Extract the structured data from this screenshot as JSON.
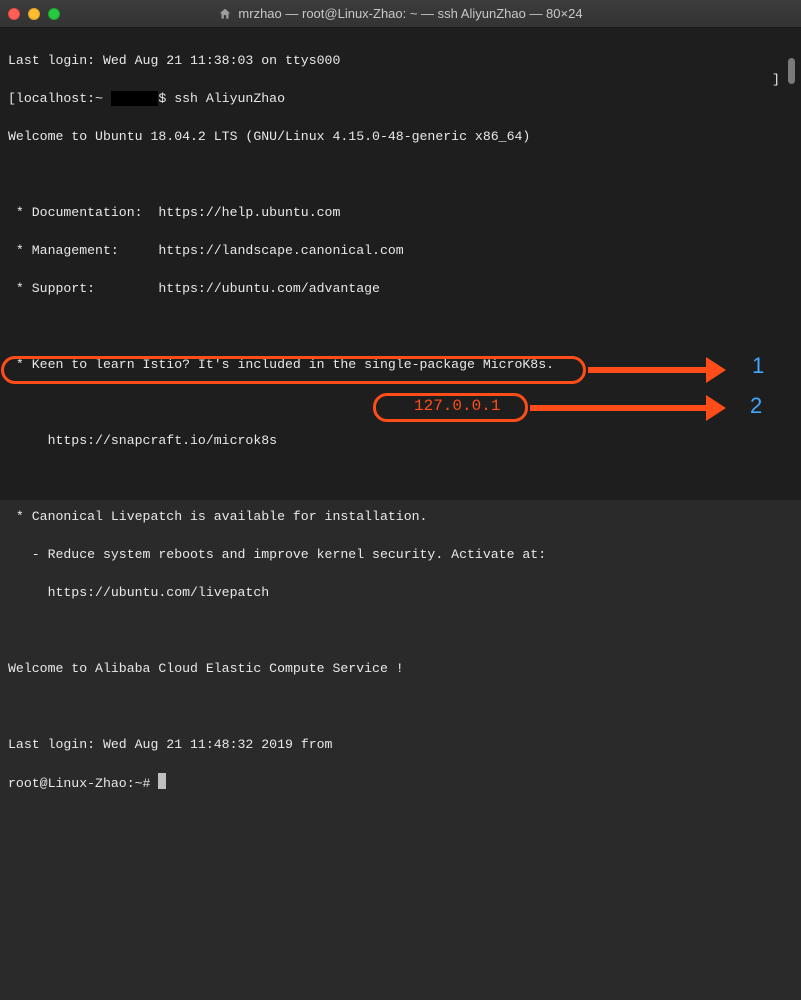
{
  "window": {
    "title": "mrzhao — root@Linux-Zhao: ~ — ssh AliyunZhao — 80×24"
  },
  "terminal": {
    "line1": "Last login: Wed Aug 21 11:38:03 on ttys000",
    "prompt_local_left": "[localhost:~ ",
    "prompt_local_right": "$ ssh AliyunZhao",
    "rbracket": "]",
    "welcome": "Welcome to Ubuntu 18.04.2 LTS (GNU/Linux 4.15.0-48-generic x86_64)",
    "doc": " * Documentation:  https://help.ubuntu.com",
    "mgmt": " * Management:     https://landscape.canonical.com",
    "support": " * Support:        https://ubuntu.com/advantage",
    "istio": " * Keen to learn Istio? It's included in the single-package MicroK8s.",
    "snap": "     https://snapcraft.io/microk8s",
    "livepatch1": " * Canonical Livepatch is available for installation.",
    "livepatch2": "   - Reduce system reboots and improve kernel security. Activate at:",
    "livepatch3": "     https://ubuntu.com/livepatch",
    "alibaba": "Welcome to Alibaba Cloud Elastic Compute Service !",
    "lastlogin2_left": "Last login: Wed Aug 21 11:48:32 2019",
    "lastlogin2_from": " from ",
    "root_prompt": "root@Linux-Zhao:~# "
  },
  "annotation": {
    "ip": "127.0.0.1",
    "num1": "1",
    "num2": "2"
  }
}
